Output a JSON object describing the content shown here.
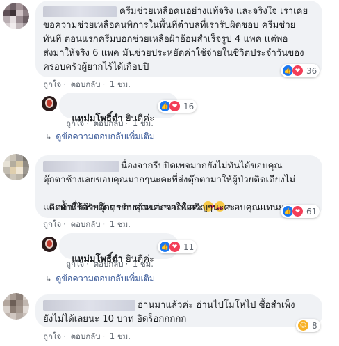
{
  "colors": {
    "bubble": "#f0f2f5",
    "link": "#385898",
    "meta": "#606770",
    "like": "#1877f2",
    "love": "#f33e58",
    "haha": "#f7b125"
  },
  "actions": {
    "like": "ถูกใจ",
    "reply": "ตอบกลับ",
    "sep": "·"
  },
  "comments": [
    {
      "lines": [
        "ครีมช่วยเหลือคนอย่างแท้จริง และจริงใจ เราเคย",
        "ขอความช่วยเหลือคนพิการในพื้นที่ตำบลที่เรารับผิดชอบ ครีมช่วย",
        "ทันที ตอนแรกครีมบอกช่วยเหลือผ้าอ้อมสำเร็จรูป 4 แพค แต่พอ",
        "ส่งมาให้จริง 6 แพค มันช่วยประหยัดค่าใช้จ่ายในชีวิตประจำวันของ",
        "ครอบครัวผู้ยากไร้ได้เกือบปี"
      ],
      "time": "1 ชม.",
      "reactions": {
        "icons": [
          "like-icon",
          "love-icon"
        ],
        "count": "36"
      },
      "reply": {
        "name": "แหม่มโพธิ์ดำ",
        "text": "ยินดีค่ะ",
        "reactions": {
          "icons": [
            "like-icon",
            "love-icon"
          ],
          "count": "16"
        },
        "time": "1 ชม."
      },
      "more_replies": "ดูข้อความตอบกลับเพิ่มเติม"
    },
    {
      "lines": [
        "นื่องจากรีบปิดเพจมากยังไม่ทันได้ขอบคุณ",
        "ตุ๊กตาช้างเลยขอบคุณมากๆนะคะที่ส่งตุ๊กตามาให้ผู้ป่วยติดเตียงไม่",
        "คิดค่าใช้จ่ายใดๆ ขอบคุณมากจากใจค่ะ",
        "และน้ำที่ได้รับตุ๊กตาช้างด้วยค่ะขอให้เจริญๆนะคะ"
      ],
      "line3_tail": "ขอบคุณแทนยาย",
      "time": "1 ชม.",
      "reactions": {
        "icons": [
          "like-icon",
          "love-icon"
        ],
        "count": "61"
      },
      "reply": {
        "name": "แหม่มโพธิ์ดำ",
        "text": "ยินดีค่ะ",
        "reactions": {
          "icons": [
            "like-icon",
            "love-icon"
          ],
          "count": "11"
        },
        "time": "1 ชม."
      },
      "more_replies": "ดูข้อความตอบกลับเพิ่มเติม"
    },
    {
      "lines": [
        "อ่านมาแล้วค่ะ อ่านไปโมโหไป ซื้อสำเพ็ง",
        "ยังไม่ได้เลยนะ 10 บาท อิดร็อกกกกก"
      ],
      "time": "1 ชม.",
      "reactions": {
        "icons": [
          "haha-icon"
        ],
        "count": "8"
      }
    }
  ]
}
